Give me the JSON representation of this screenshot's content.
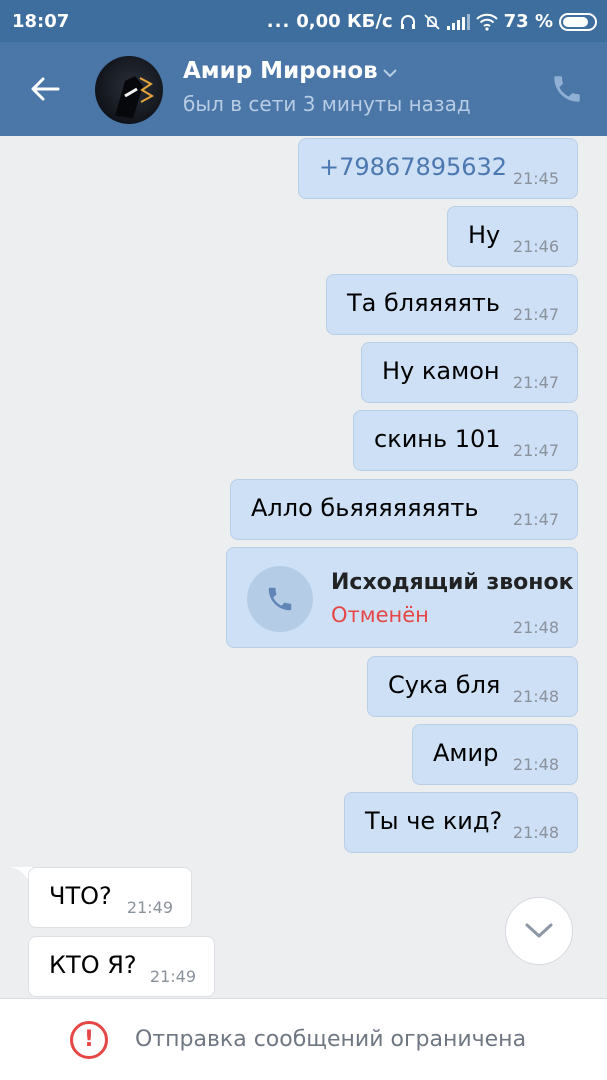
{
  "status_bar": {
    "time": "18:07",
    "dots": "...",
    "speed": "0,00 КБ/с",
    "battery": "73 %"
  },
  "header": {
    "contact_name": "Амир Миронов",
    "last_seen": "был в сети 3 минуты назад"
  },
  "messages": [
    {
      "text": "+79867895632",
      "time": "21:45"
    },
    {
      "text": "Ну",
      "time": "21:46"
    },
    {
      "text": "Та бляяяять",
      "time": "21:47"
    },
    {
      "text": "Ну камон",
      "time": "21:47"
    },
    {
      "text": "скинь 101",
      "time": "21:47"
    },
    {
      "text": "Алло бьяяяяяяять",
      "time": "21:47"
    },
    {
      "call_title": "Исходящий звонок",
      "call_status": "Отменён",
      "time": "21:48"
    },
    {
      "text": "Сука бля",
      "time": "21:48"
    },
    {
      "text": "Амир",
      "time": "21:48"
    },
    {
      "text": "Ты че кид?",
      "time": "21:48"
    },
    {
      "text": "ЧТО?",
      "time": "21:49"
    },
    {
      "text": "КТО Я?",
      "time": "21:49"
    }
  ],
  "footer": {
    "warning_symbol": "!",
    "restriction_text": "Отправка сообщений ограничена"
  },
  "colors": {
    "header_bg": "#4a76a8",
    "statusbar_bg": "#3e6e9e",
    "outgoing_bubble": "#cde0f5",
    "incoming_bubble": "#ffffff",
    "link": "#4b78b0",
    "cancelled": "#e64646"
  },
  "icons": [
    "back-arrow-icon",
    "chevron-down-icon",
    "phone-icon",
    "headphones-icon",
    "mute-bell-icon",
    "signal-icon",
    "wifi-icon",
    "battery-icon",
    "warning-icon"
  ]
}
